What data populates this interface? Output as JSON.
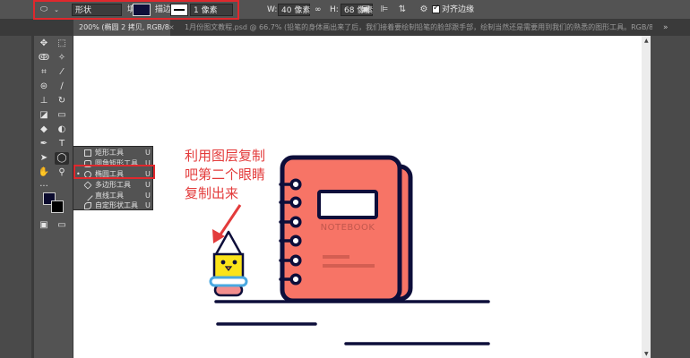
{
  "options_bar": {
    "mode": "形状",
    "fill_label": "填充:",
    "stroke_label": "描边:",
    "stroke_width": "1 像素",
    "w_label": "W:",
    "w_value": "40 像素",
    "link_glyph": "∞",
    "h_label": "H:",
    "h_value": "68 像素",
    "align_edges_label": "对齐边缘",
    "fill_color": "#0f0f3a"
  },
  "tabs": [
    {
      "label": "200% (椭圆 2 拷贝, RGB/8#) *",
      "close": "×"
    },
    {
      "label": "1月份图文教程.psd @ 66.7% (铅笔的身体画出来了后，我们接着要绘制铅笔的脸部跟手部，绘制当然还是需要用到我们的熟悉的图形工具。RGB/8..."
    }
  ],
  "tab_overflow": "»",
  "toolbar": {
    "tools": [
      "move-tool",
      "marquee-tool",
      "lasso-tool",
      "magic-wand-tool",
      "crop-tool",
      "eyedropper-tool",
      "healing-tool",
      "brush-tool",
      "stamp-tool",
      "history-brush-tool",
      "eraser-tool",
      "gradient-tool",
      "blur-tool",
      "dodge-tool",
      "pen-tool",
      "type-tool",
      "path-select-tool",
      "shape-tool",
      "hand-tool",
      "zoom-tool"
    ],
    "foreground_color": "#0b0b2e",
    "background_color": "#000000"
  },
  "flyout": {
    "items": [
      {
        "label": "矩形工具",
        "shortcut": "U"
      },
      {
        "label": "圆角矩形工具",
        "shortcut": "U"
      },
      {
        "label": "椭圆工具",
        "shortcut": "U",
        "bullet": "•"
      },
      {
        "label": "多边形工具",
        "shortcut": "U"
      },
      {
        "label": "直线工具",
        "shortcut": "U"
      },
      {
        "label": "自定形状工具",
        "shortcut": "U"
      }
    ]
  },
  "canvas": {
    "annotation": "利用图层复制\n吧第二个眼睛\n复制出来",
    "notebook_label": "NOTEBOOK",
    "colors": {
      "navy": "#0d0e3a",
      "salmon": "#f77466",
      "yellow": "#fbe31a",
      "blue_ring": "#4aa8e0",
      "pink": "#f28d8d",
      "annotation_red": "#e33b3b"
    }
  }
}
